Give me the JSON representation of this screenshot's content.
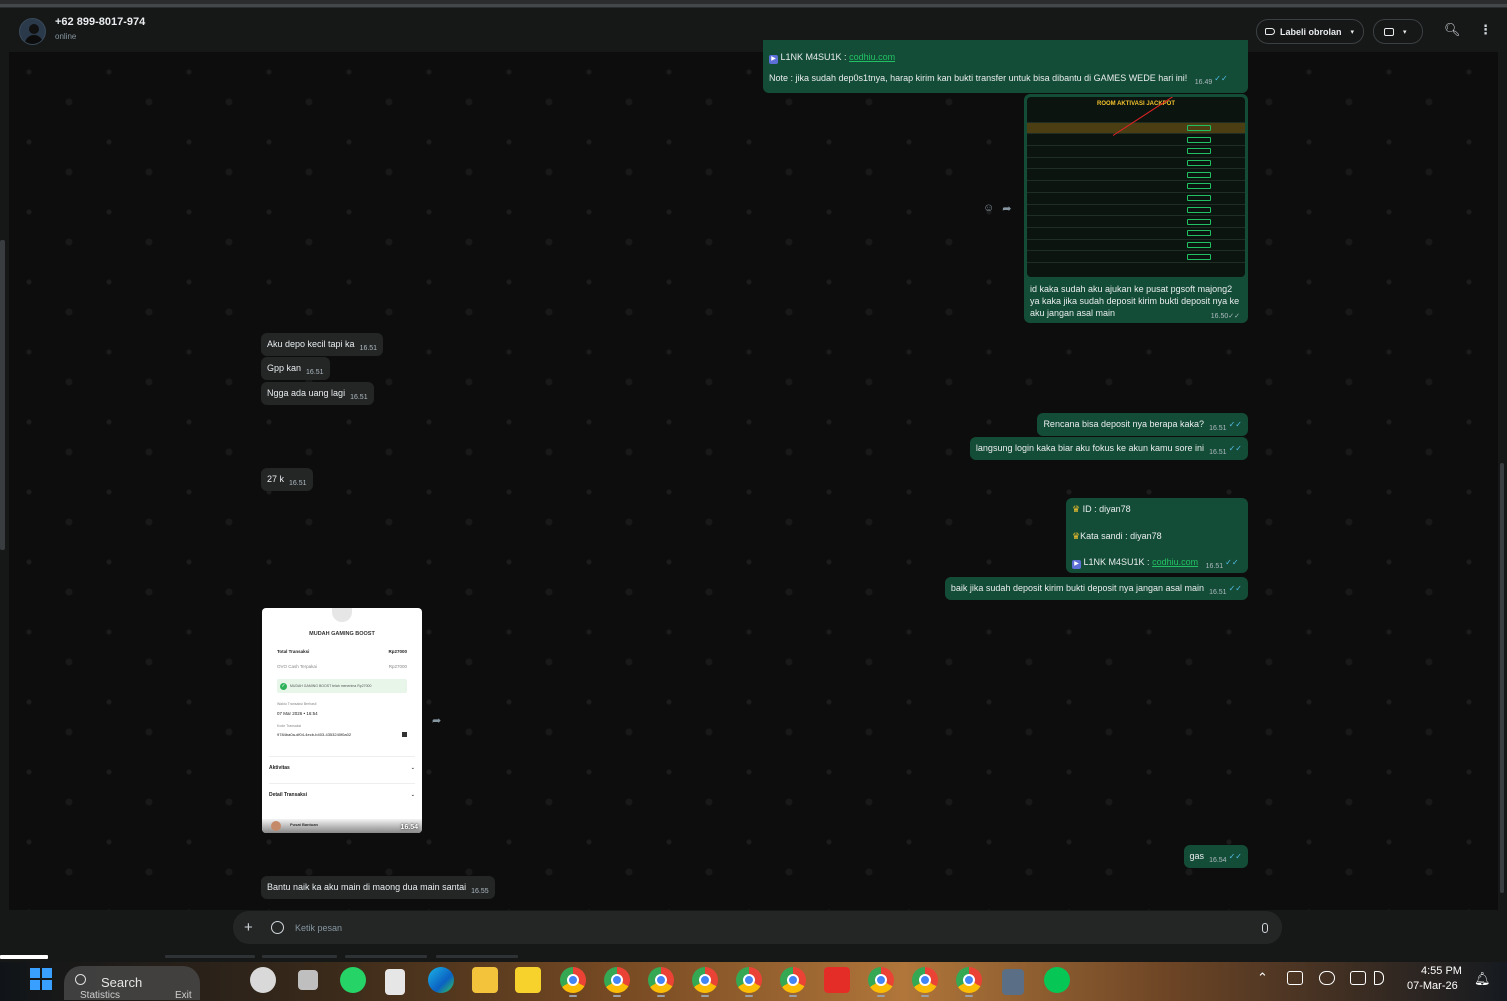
{
  "header": {
    "contact_name": "+62 899-8017-974",
    "status": "online",
    "label_button": "Labeli obrolan"
  },
  "messages": {
    "m1_line1_prefix": "L1NK M4SU1K :",
    "m1_line1_link": "codhiu.com",
    "m1_line2": "Note : jika sudah dep0s1tnya, harap kirim kan bukti transfer untuk bisa dibantu di GAMES WEDE hari ini!",
    "m1_time": "16.49",
    "media_title": "ROOM AKTIVASI JACKPOT",
    "media_caption": "id kaka sudah aku ajukan ke pusat pgsoft majong2 ya kaka jika sudah deposit kirim bukti deposit nya ke aku jangan asal main",
    "media_time": "16.50",
    "in1": "Aku depo kecil tapi ka",
    "in1_time": "16.51",
    "in2": "Gpp kan",
    "in2_time": "16.51",
    "in3": "Ngga ada uang lagi",
    "in3_time": "16.51",
    "out1": "Rencana bisa deposit nya berapa kaka?",
    "out1_time": "16.51",
    "out2": "langsung login kaka biar aku fokus ke akun kamu sore ini",
    "out2_time": "16.51",
    "in4": "27 k",
    "in4_time": "16.51",
    "cred_id": "ID :  diyan78",
    "cred_pw": "Kata sandi : diyan78",
    "cred_link_prefix": "L1NK M4SU1K :",
    "cred_link": "codhiu.com",
    "cred_time": "16.51",
    "out3": "baik jika sudah deposit kirim bukti deposit nya jangan asal main",
    "out3_time": "16.51",
    "receipt_time": "16.54",
    "out4": "gas",
    "out4_time": "16.54",
    "in5": "Bantu naik ka aku main di maong dua main santai",
    "in5_time": "16.55"
  },
  "receipt": {
    "title": "MUDAH GAMING BOOST",
    "total_label": "Total Transaksi",
    "total_value": "Rp27000",
    "ovo_label": "OVO Cash Terpakai",
    "ovo_value": "Rp27000",
    "success_text": "MUDAH GAMING BOOST telah menerima Rp27000",
    "time_label": "Waktu Transaksi Berhasil",
    "time_value": "07 Mar 2026 • 16:54",
    "code_label": "Kode Transaksi",
    "code_value": "9784ba0a-df04-4ecb-b403-4353240f0a02",
    "section1": "Aktivitas",
    "section2": "Detail Transaksi",
    "footer": "Pusat Bantuan"
  },
  "composer": {
    "placeholder": "Ketik pesan"
  },
  "taskbar": {
    "search_label": "Search",
    "statistics": "Statistics",
    "exit": "Exit",
    "time": "4:55 PM",
    "date": "07-Mar-26"
  },
  "colors": {
    "outgoing_bubble": "#144d37",
    "incoming_bubble": "#242626",
    "link": "#21c063",
    "read_tick": "#53bdeb"
  }
}
